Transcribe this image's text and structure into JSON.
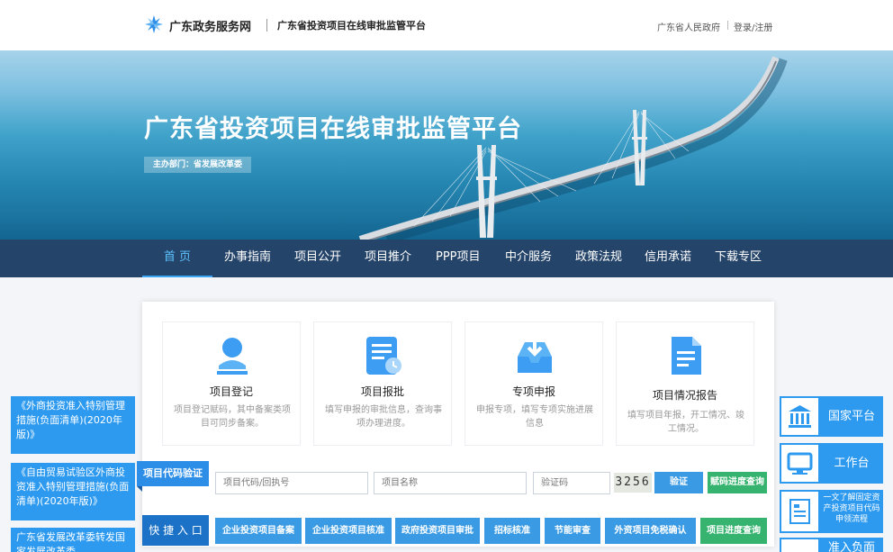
{
  "header": {
    "logo_text": "广东政务服务网",
    "sub_title": "广东省投资项目在线审批监管平台",
    "gov_link": "广东省人民政府",
    "login": "登录/注册"
  },
  "banner": {
    "title": "广东省投资项目在线审批监管平台",
    "badge": "主办部门：省发展改革委"
  },
  "nav": [
    "首 页",
    "办事指南",
    "项目公开",
    "项目推介",
    "PPP项目",
    "中介服务",
    "政策法规",
    "信用承诺",
    "下载专区"
  ],
  "services": [
    {
      "title": "项目登记",
      "desc": "项目登记赋码，其中备案类项目可同步备案。",
      "icon": "user-register-icon"
    },
    {
      "title": "项目报批",
      "desc": "填写申报的审批信息，查询事项办理进度。",
      "icon": "document-clock-icon"
    },
    {
      "title": "专项申报",
      "desc": "申报专项，填写专项实施进展信息",
      "icon": "inbox-download-icon"
    },
    {
      "title": "项目情况报告",
      "desc": "填写项目年报，开工情况、竣工情况。",
      "icon": "report-file-icon"
    }
  ],
  "verify": {
    "label": "项目代码验证",
    "code_placeholder": "项目代码/回执号",
    "name_placeholder": "项目名称",
    "captcha_placeholder": "验证码",
    "captcha_text": "3256",
    "verify_button": "验证",
    "progress_button": "赋码进度查询"
  },
  "quick": {
    "label": "快 捷 入 口",
    "items": [
      "企业投资项目备案",
      "企业投资项目核准",
      "政府投资项目审批",
      "招标核准",
      "节能审查",
      "外资项目免税确认",
      "项目进度查询"
    ]
  },
  "notices": [
    "《外商投资准入特别管理措施(负面清单)(2020年版)》",
    "《自由贸易试验区外商投资准入特别管理措施(负面清单)(2020年版)》",
    "广东省发展改革委转发国家发展改革委"
  ],
  "side": [
    {
      "label": "国家平台",
      "icon": "government-building-icon"
    },
    {
      "label": "工作台",
      "icon": "monitor-icon"
    },
    {
      "label": "一文了解固定资产投资项目代码申领流程",
      "icon": "flowchart-icon"
    },
    {
      "label": "准入负面",
      "icon": "list-icon"
    }
  ],
  "colors": {
    "primary": "#2d9af0",
    "nav_bg": "#14345c",
    "green": "#36b36f"
  }
}
